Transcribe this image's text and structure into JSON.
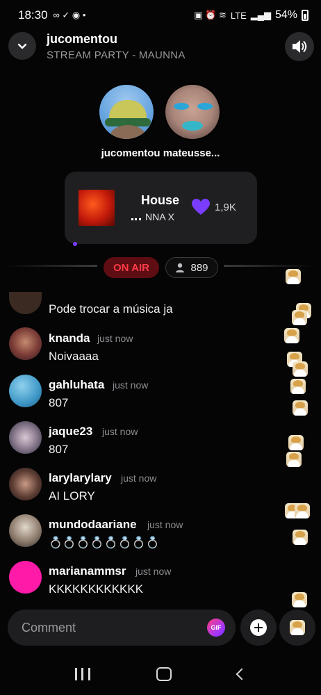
{
  "status_bar": {
    "time": "18:30",
    "battery": "54%",
    "network": "LTE"
  },
  "header": {
    "title": "jucomentou",
    "subtitle": "STREAM PARTY - MAUNNA"
  },
  "hosts": {
    "label": "jucomentou mateusse..."
  },
  "now_playing": {
    "title": "House",
    "artist": "NNA X",
    "likes": "1,9K"
  },
  "live": {
    "badge": "ON AIR",
    "listener_count": "889"
  },
  "comments": [
    {
      "user": "",
      "time": "",
      "text": "Pode trocar a música ja"
    },
    {
      "user": "knanda",
      "time": "just now",
      "text": "Noivaaaa"
    },
    {
      "user": "gahluhata",
      "time": "just now",
      "text": "807"
    },
    {
      "user": "jaque23",
      "time": "just now",
      "text": "807"
    },
    {
      "user": "larylarylary",
      "time": "just now",
      "text": "AI LORY"
    },
    {
      "user": "mundodaariane",
      "time": "just now",
      "text": "💍💍💍💍💍💍💍💍"
    },
    {
      "user": "marianammsr",
      "time": "just now",
      "text": "KKKKKKKKKKKK"
    }
  ],
  "composer": {
    "placeholder": "Comment",
    "gif_label": "GIF"
  },
  "icons": {
    "collapse": "chevron-down-icon",
    "volume": "speaker-icon",
    "like": "heart-icon",
    "listeners": "person-icon",
    "add": "plus-icon",
    "reaction": "bride-emoji-icon"
  },
  "colors": {
    "accent_purple": "#7a3cff",
    "on_air_red": "#ff3b4a",
    "gif_gradient": "#ff3c7d"
  }
}
